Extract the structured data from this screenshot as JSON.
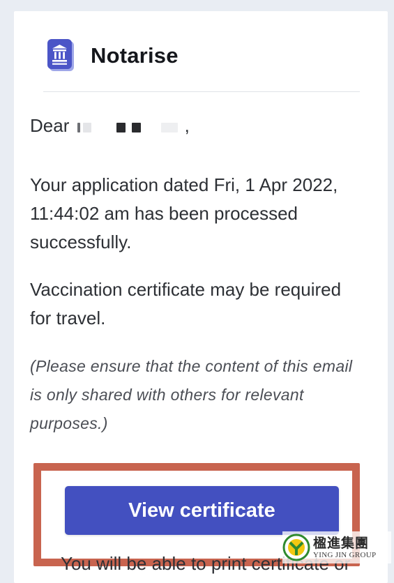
{
  "brand": {
    "name": "Notarise"
  },
  "email": {
    "greeting_prefix": "Dear",
    "greeting_suffix": ",",
    "paragraph1": "Your application dated Fri, 1 Apr 2022, 11:44:02 am has been processed successfully.",
    "paragraph2": "Vaccination certificate may be required for travel.",
    "note": "(Please ensure that the content of this email is only shared with others for relevant purposes.)",
    "cta_label": "View certificate",
    "footer_cutoff": "You will be able to print certificate or"
  },
  "watermark": {
    "chinese": "楹進集團",
    "english": "YING JIN GROUP",
    "logo_letter": "Y"
  },
  "colors": {
    "accent": "#4350c0",
    "highlight_box": "#c8644f",
    "background": "#e9edf3"
  },
  "icons": {
    "brand_logo": "institution-building-icon"
  }
}
